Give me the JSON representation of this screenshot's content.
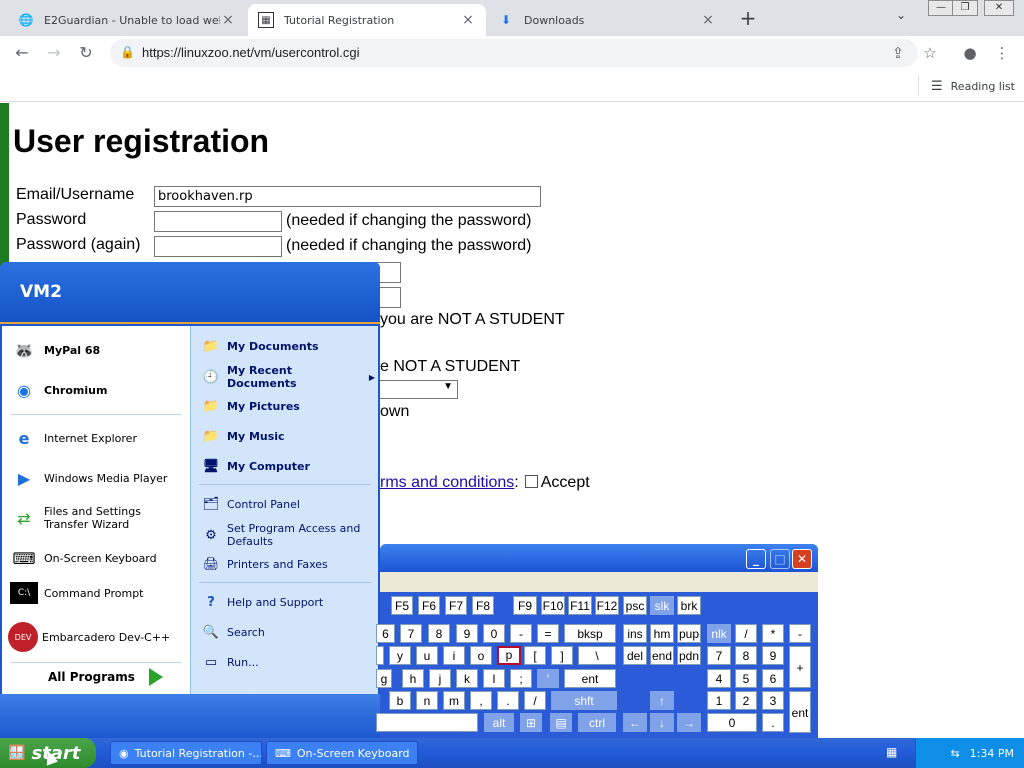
{
  "browser": {
    "tabs": [
      {
        "title": "E2Guardian - Unable to load websit",
        "icon": "globe-icon"
      },
      {
        "title": "Tutorial Registration",
        "icon": "site-icon"
      },
      {
        "title": "Downloads",
        "icon": "download-icon"
      }
    ],
    "url": "https://linuxzoo.net/vm/usercontrol.cgi",
    "reading_list": "Reading list"
  },
  "page": {
    "title": "User registration",
    "email_label": "Email/Username",
    "email_value": "brookhaven.rp",
    "password_label": "Password",
    "password_note": "(needed if changing the password)",
    "password_again_label": "Password (again)",
    "password_again_note": "(needed if changing the password)",
    "fragment_not_student_1": "you are NOT A STUDENT",
    "fragment_not_student_2": "e NOT A STUDENT",
    "fragment_own": "own",
    "terms_link": "rms and conditions",
    "terms_colon": ":",
    "accept_label": "Accept"
  },
  "start_menu": {
    "user": "VM2",
    "pinned": [
      "MyPal 68",
      "Chromium"
    ],
    "recent": [
      "Internet Explorer",
      "Windows Media Player",
      "Files and Settings Transfer Wizard",
      "On-Screen Keyboard",
      "Command Prompt",
      "Embarcadero Dev-C++"
    ],
    "all_programs": "All Programs",
    "places": [
      "My Documents",
      "My Recent Documents",
      "My Pictures",
      "My Music",
      "My Computer"
    ],
    "system": [
      "Control Panel",
      "Set Program Access and Defaults",
      "Printers and Faxes"
    ],
    "help": [
      "Help and Support",
      "Search",
      "Run..."
    ]
  },
  "keyboard": {
    "row1": [
      "F5",
      "F6",
      "F7",
      "F8",
      "F9",
      "F10",
      "F11",
      "F12",
      "psc",
      "slk",
      "brk"
    ],
    "row2": [
      "6",
      "7",
      "8",
      "9",
      "0",
      "-",
      "=",
      "bksp",
      "ins",
      "hm",
      "pup",
      "nlk",
      "/",
      "*",
      "-"
    ],
    "row3": [
      "y",
      "u",
      "i",
      "o",
      "p",
      "[",
      "]",
      "\\",
      "del",
      "end",
      "pdn",
      "7",
      "8",
      "9",
      "+"
    ],
    "row4": [
      "g",
      "h",
      "j",
      "k",
      "l",
      ";",
      "'",
      "ent",
      "4",
      "5",
      "6"
    ],
    "row5": [
      "b",
      "n",
      "m",
      ",",
      ".",
      "/",
      "shft",
      "↑",
      "1",
      "2",
      "3",
      "ent"
    ],
    "row6": [
      "alt",
      "ctrl",
      "←",
      "↓",
      "→",
      "0",
      "."
    ]
  },
  "taskbar": {
    "start": "start",
    "tasks": [
      "Tutorial Registration -...",
      "On-Screen Keyboard"
    ],
    "clock": "1:34 PM"
  },
  "colors": {
    "xp_blue": "#245edb",
    "start_green": "#2d8b2d",
    "page_accent_green": "#1e7a1e"
  }
}
